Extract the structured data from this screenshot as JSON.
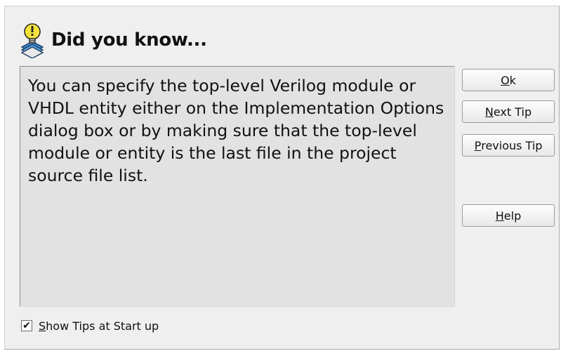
{
  "dialog": {
    "title": "Did you know...",
    "icon": "lightbulb-tip-icon",
    "tip_text": "You can specify the top-level Verilog module or VHDL entity either on the Implementation Options dialog box or by making sure that the top-level module or entity is the last file in the project source file list.",
    "buttons": {
      "ok": {
        "mnemonic": "O",
        "rest": "k"
      },
      "next": {
        "mnemonic": "N",
        "rest": "ext Tip"
      },
      "previous": {
        "mnemonic": "P",
        "rest": "revious Tip"
      },
      "help": {
        "mnemonic": "H",
        "rest": "elp"
      }
    },
    "show_tips": {
      "checked": true,
      "check_glyph": "✔",
      "mnemonic": "S",
      "rest": "how Tips at Start up"
    }
  },
  "colors": {
    "dialog_bg": "#efefef",
    "tip_box_bg": "#e2e2e2",
    "text": "#111111",
    "icon_yellow": "#f4e23a",
    "icon_blue": "#3c86c9"
  }
}
